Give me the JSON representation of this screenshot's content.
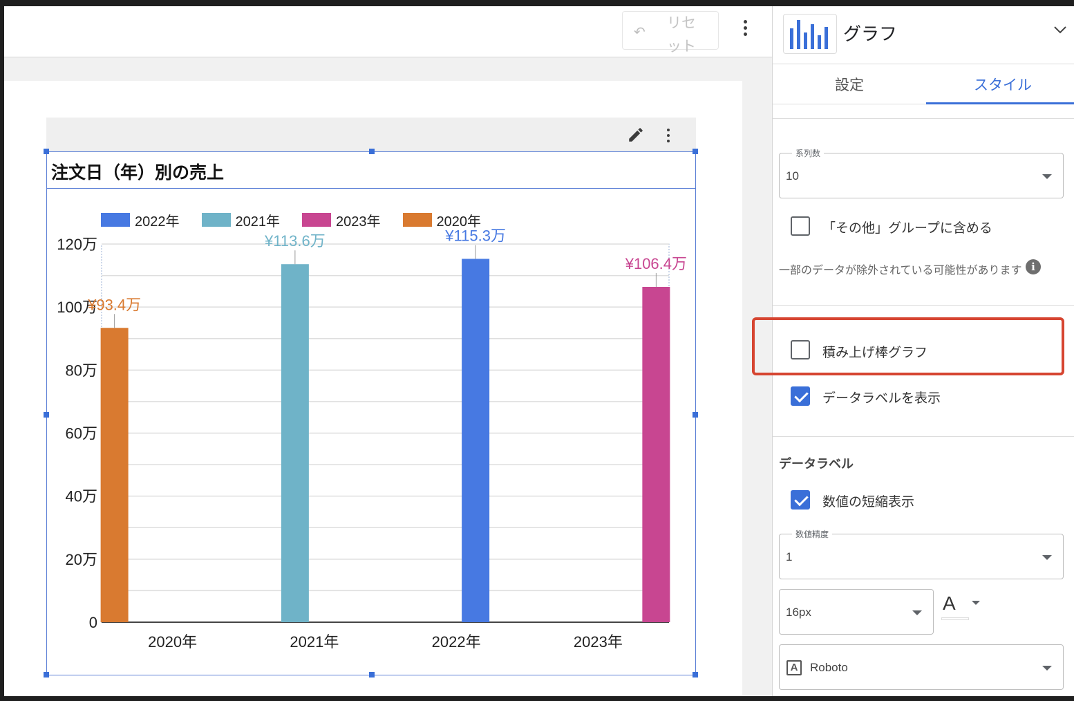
{
  "toolbar": {
    "reset_label": "リセット",
    "reset_line1": "リセ",
    "reset_line2": "ット"
  },
  "chart": {
    "title": "注文日（年）別の売上"
  },
  "chart_data": {
    "type": "bar",
    "title": "注文日（年）別の売上",
    "categories": [
      "2020年",
      "2021年",
      "2022年",
      "2023年"
    ],
    "series": [
      {
        "name": "2022年",
        "color": "#4779e2",
        "values": [
          null,
          null,
          115.3,
          null
        ]
      },
      {
        "name": "2021年",
        "color": "#6fb3c8",
        "values": [
          null,
          113.6,
          null,
          null
        ]
      },
      {
        "name": "2023年",
        "color": "#c84691",
        "values": [
          null,
          null,
          null,
          106.4
        ]
      },
      {
        "name": "2020年",
        "color": "#d97a30",
        "values": [
          93.4,
          null,
          null,
          null
        ]
      }
    ],
    "data_labels": [
      "¥93.4万",
      "¥113.6万",
      "¥115.3万",
      "¥106.4万"
    ],
    "yticks": [
      "0",
      "20万",
      "40万",
      "60万",
      "80万",
      "100万",
      "120万"
    ],
    "ylim": [
      0,
      120
    ],
    "yunit": "万",
    "grid": true,
    "legend_position": "top-left"
  },
  "panel": {
    "title": "グラフ",
    "tabs": [
      "設定",
      "スタイル"
    ],
    "active_tab": "スタイル",
    "series_count": {
      "label": "系列数",
      "value": "10"
    },
    "include_others": {
      "label": "「その他」グループに含める",
      "checked": false
    },
    "note": "一部のデータが除外されている可能性があります",
    "stacked": {
      "label": "積み上げ棒グラフ",
      "checked": false
    },
    "show_labels": {
      "label": "データラベルを表示",
      "checked": true
    },
    "data_label_section": "データラベル",
    "compact_numbers": {
      "label": "数値の短縮表示",
      "checked": true
    },
    "precision": {
      "label": "数値精度",
      "value": "1"
    },
    "font_size": {
      "value": "16px"
    },
    "font_color_glyph": "A",
    "font_family": {
      "value": "Roboto"
    },
    "highlight_color": "#d64531",
    "accent_color": "#3a6fd8"
  }
}
